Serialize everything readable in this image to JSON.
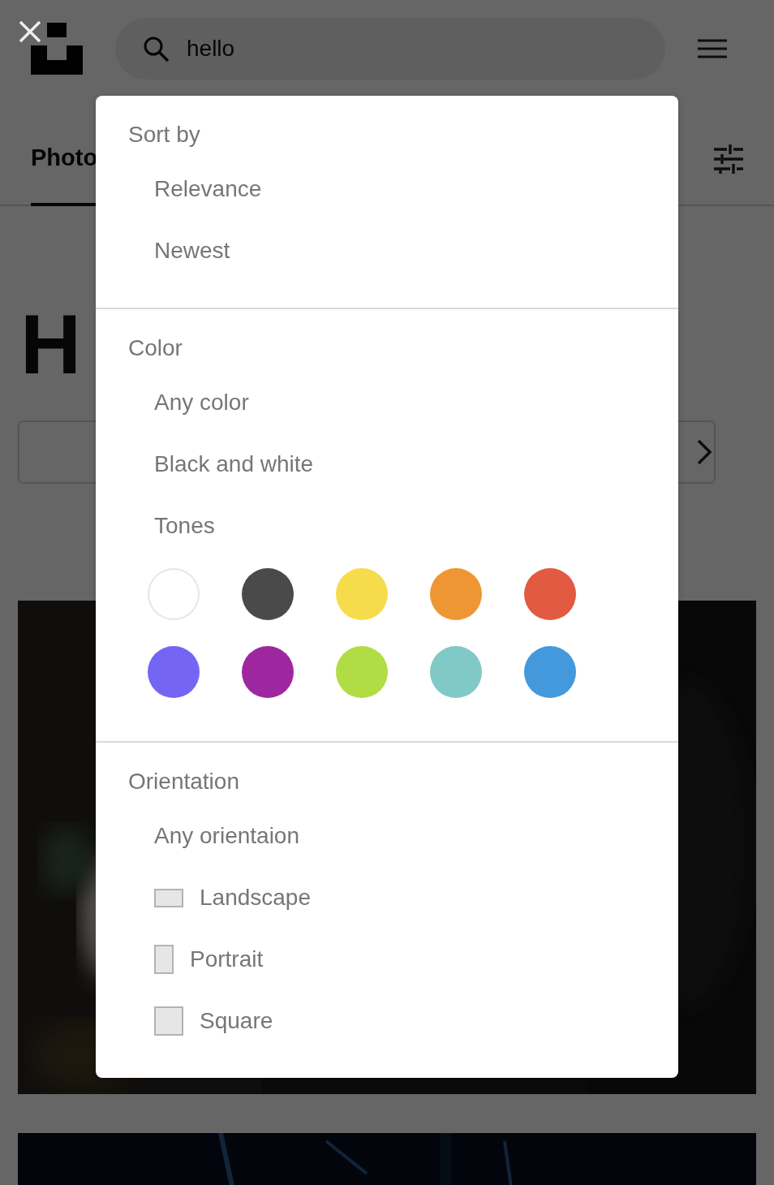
{
  "header": {
    "search": {
      "value": "hello"
    }
  },
  "tabs": [
    {
      "label": "Photo",
      "selected": true
    }
  ],
  "heading": "H",
  "filters": {
    "sections": [
      {
        "title": "Sort by",
        "items": [
          {
            "label": "Relevance",
            "kind": "plain"
          },
          {
            "label": "Newest",
            "kind": "plain"
          }
        ]
      },
      {
        "title": "Color",
        "items": [
          {
            "label": "Any color",
            "kind": "plain"
          },
          {
            "label": "Black and white",
            "kind": "plain"
          },
          {
            "label": "Tones",
            "kind": "plain"
          }
        ],
        "swatches": [
          {
            "color": "#ffffff"
          },
          {
            "color": "#4a4a4a"
          },
          {
            "color": "#f6dc4b"
          },
          {
            "color": "#ee9634"
          },
          {
            "color": "#e25a41"
          },
          {
            "color": "#7565f4"
          },
          {
            "color": "#9e27a0"
          },
          {
            "color": "#b2dc44"
          },
          {
            "color": "#81c9c7"
          },
          {
            "color": "#4399dc"
          }
        ]
      },
      {
        "title": "Orientation",
        "items": [
          {
            "label": "Any orientaion",
            "kind": "plain"
          },
          {
            "label": "Landscape",
            "kind": "landscape"
          },
          {
            "label": "Portrait",
            "kind": "portrait"
          },
          {
            "label": "Square",
            "kind": "square"
          }
        ]
      }
    ]
  }
}
